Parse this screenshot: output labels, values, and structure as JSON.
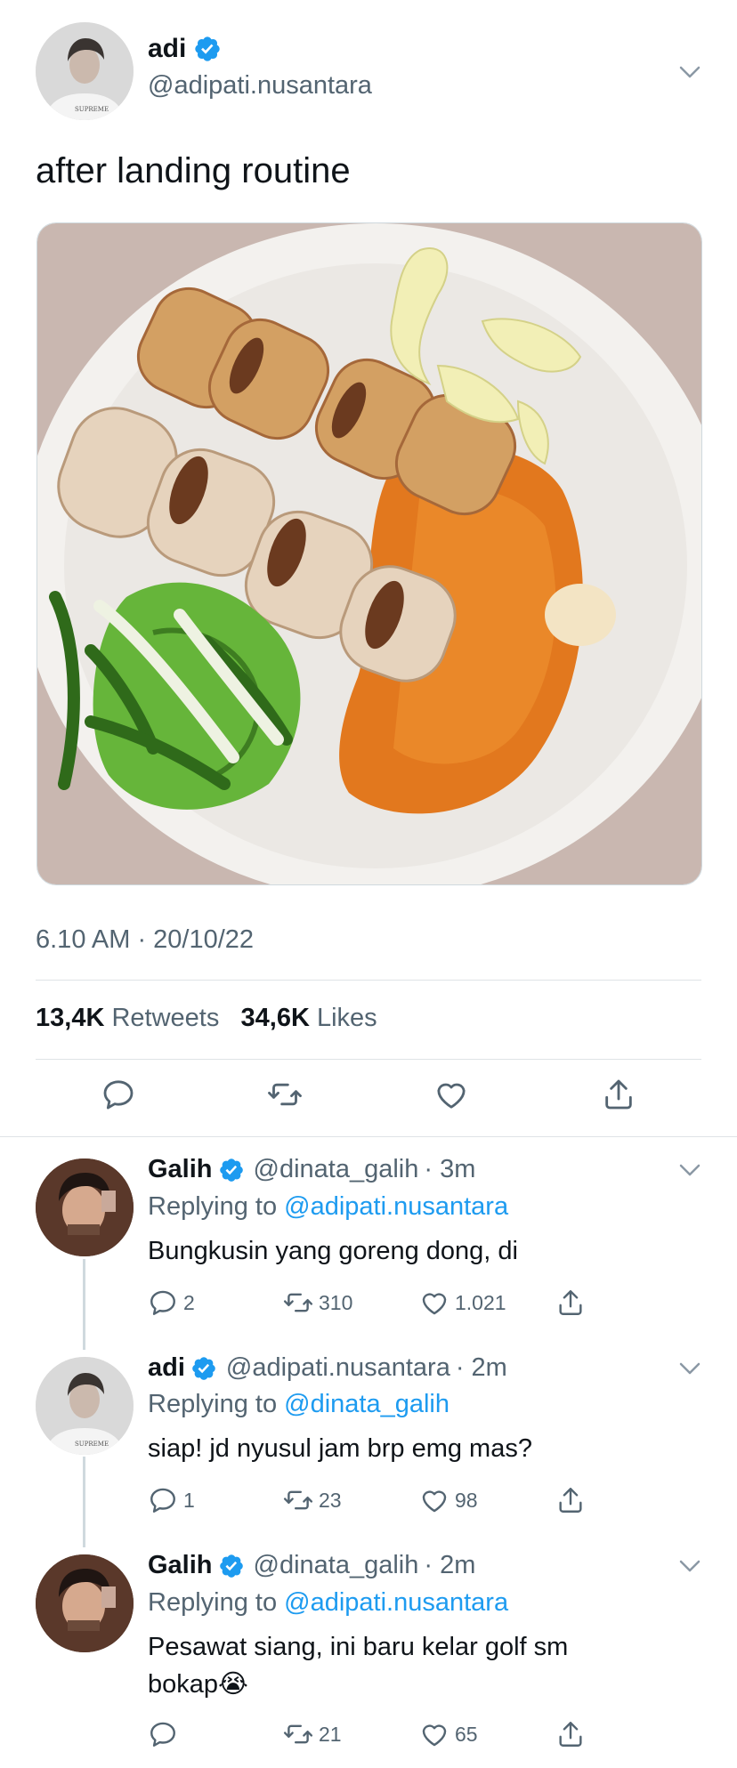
{
  "main_tweet": {
    "display_name": "adi",
    "handle": "@adipati.nusantara",
    "text": "after landing routine",
    "timestamp": "6.10 AM · 20/10/22",
    "retweets_count": "13,4K",
    "retweets_label": "Retweets",
    "likes_count": "34,6K",
    "likes_label": "Likes"
  },
  "replies": [
    {
      "display_name": "Galih",
      "handle": "@dinata_galih",
      "time": "· 3m",
      "replying_prefix": "Replying to",
      "replying_to": "@adipati.nusantara",
      "text": "Bungkusin yang goreng dong, di",
      "reply_count": "2",
      "retweet_count": "310",
      "like_count": "1.021"
    },
    {
      "display_name": "adi",
      "handle": "@adipati.nusantara",
      "time": "· 2m",
      "replying_prefix": "Replying to",
      "replying_to": "@dinata_galih",
      "text": "siap! jd nyusul jam brp emg mas?",
      "reply_count": "1",
      "retweet_count": "23",
      "like_count": "98"
    },
    {
      "display_name": "Galih",
      "handle": "@dinata_galih",
      "time": "· 2m",
      "replying_prefix": "Replying to",
      "replying_to": "@adipati.nusantara",
      "text_line1": "Pesawat siang, ini baru kelar golf sm",
      "text_line2": "bokap",
      "emoji": "😭",
      "reply_count": "",
      "retweet_count": "21",
      "like_count": "65"
    }
  ],
  "colors": {
    "accent": "#1d9bf0",
    "muted": "#536471",
    "text": "#0f1419",
    "divider": "#dfe3e6"
  },
  "icons": [
    "verified-badge-icon",
    "chevron-down-icon",
    "reply-icon",
    "retweet-icon",
    "like-icon",
    "share-icon"
  ]
}
